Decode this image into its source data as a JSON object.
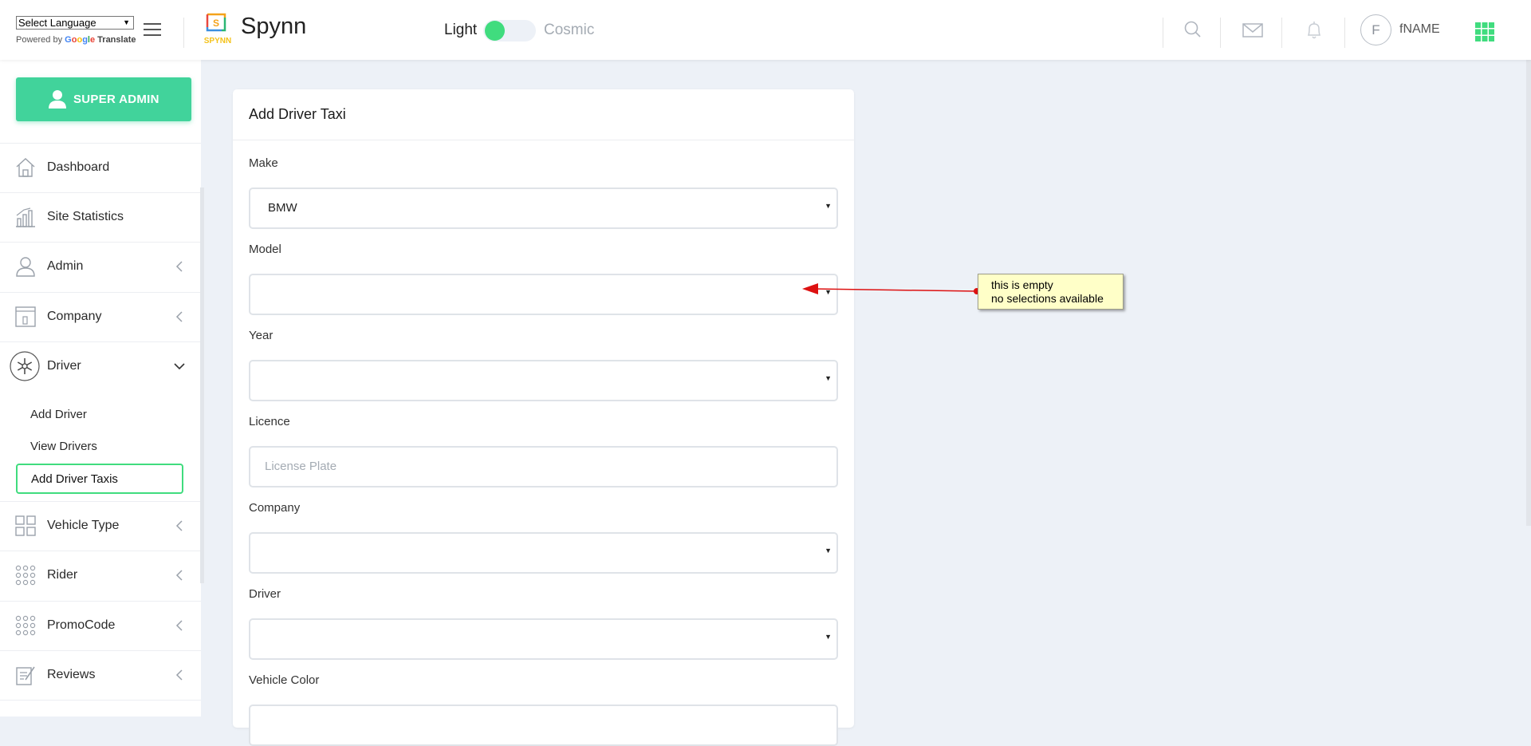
{
  "header": {
    "language_select": "Select Language",
    "powered_by": "Powered by",
    "google": "Google",
    "translate": "Translate",
    "logo_text": "SPYNN",
    "brand": "Spynn",
    "theme_light": "Light",
    "theme_cosmic": "Cosmic",
    "avatar_initial": "F",
    "user_name": "fNAME",
    "accent_color": "#40dc7e"
  },
  "sidebar": {
    "role_button": "SUPER ADMIN",
    "items": [
      {
        "label": "Dashboard",
        "icon": "home-icon"
      },
      {
        "label": "Site Statistics",
        "icon": "bar-chart-icon"
      },
      {
        "label": "Admin",
        "icon": "person-icon"
      },
      {
        "label": "Company",
        "icon": "building-icon"
      },
      {
        "label": "Driver",
        "icon": "snowflake-icon"
      },
      {
        "label": "Vehicle Type",
        "icon": "grid-icon"
      },
      {
        "label": "Rider",
        "icon": "dots-grid-icon"
      },
      {
        "label": "PromoCode",
        "icon": "dots-grid-icon"
      },
      {
        "label": "Reviews",
        "icon": "edit-icon"
      }
    ],
    "driver_sub": [
      "Add Driver",
      "View Drivers",
      "Add Driver Taxis"
    ]
  },
  "form": {
    "title": "Add Driver Taxi",
    "make_label": "Make",
    "make_value": "BMW",
    "model_label": "Model",
    "model_value": "",
    "year_label": "Year",
    "year_value": "",
    "licence_label": "Licence",
    "licence_placeholder": "License Plate",
    "company_label": "Company",
    "company_value": "",
    "driver_label": "Driver",
    "driver_value": "",
    "color_label": "Vehicle Color"
  },
  "annotation": {
    "line1": "this is empty",
    "line2": "no selections available"
  }
}
